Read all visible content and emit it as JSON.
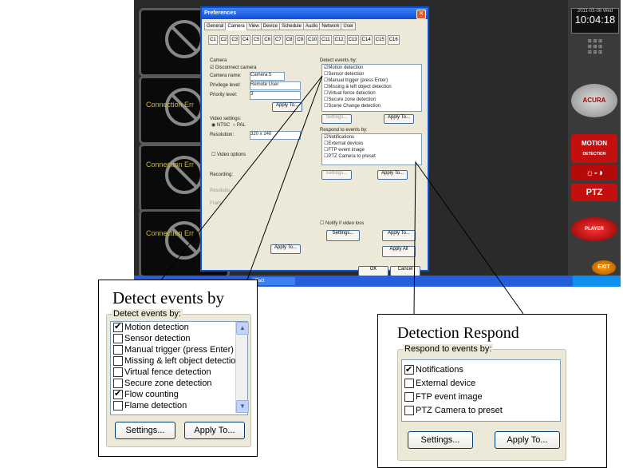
{
  "background_app": {
    "camera_tiles": [
      {
        "status": ""
      },
      {
        "status": "Connection Err"
      },
      {
        "status": "Connection Err"
      },
      {
        "status": "Connection Err"
      }
    ],
    "clock": {
      "date": "2011-03-08 Wed",
      "time": "10:04:18"
    },
    "side_buttons": {
      "motion_line1": "MOTION",
      "motion_line2": "DETECTION",
      "ptz": "PTZ",
      "acura": "ACURA",
      "player": "PLAYER",
      "exit": "EXIT"
    }
  },
  "preferences_dialog": {
    "title": "Preferences",
    "tabs": [
      "General",
      "Camera",
      "View",
      "Device",
      "Schedule",
      "Audio",
      "Network",
      "User"
    ],
    "camera_tabs": [
      "C1",
      "C2",
      "C3",
      "C4",
      "C5",
      "C6",
      "C7",
      "C8",
      "C9",
      "C10",
      "C11",
      "C12",
      "C13",
      "C14",
      "C15",
      "C16"
    ],
    "camera_group": {
      "label": "Camera",
      "disconnect_label": "Disconnect camera",
      "name_label": "Camera name:",
      "name_value": "Camera 5",
      "privilege_label": "Privilege level:",
      "privilege_value": "Remote User",
      "priority_label": "Priority level:",
      "priority_value": "3",
      "apply_to": "Apply To..."
    },
    "video_settings": {
      "label": "Video settings:",
      "ntsc": "NTSC",
      "pal": "PAL",
      "resolution_label": "Resolution:",
      "resolution_value": "320 x 240",
      "video_options": "Video options"
    },
    "recording": {
      "label": "Recording:",
      "resolution_label": "Resolutio",
      "framerate_label": "Fram",
      "apply_to": "Apply To..."
    },
    "detect_label": "Detect events by:",
    "detect_items": [
      "Motion detection",
      "Sensor detection",
      "Manual trigger (press Enter)",
      "Missing & left object detection",
      "Virtual fence detection",
      "Secure zone detection",
      "Scene Change detection"
    ],
    "respond_label": "Respond to events by:",
    "respond_items": [
      "Notifications",
      "External devices",
      "FTP event image",
      "PTZ Camera to preset"
    ],
    "settings_btn": "Settings...",
    "apply_to_btn": "Apply To...",
    "notify_video_loss": "Notify if video loss",
    "apply_all": "Apply All",
    "ok": "OK",
    "cancel": "Cancel"
  },
  "callout_detect": {
    "heading": "Detect events by",
    "group_label": "Detect events by:",
    "items": [
      {
        "label": "Motion detection",
        "checked": true
      },
      {
        "label": "Sensor detection",
        "checked": false
      },
      {
        "label": "Manual trigger (press Enter)",
        "checked": false
      },
      {
        "label": "Missing & left object detection",
        "checked": false
      },
      {
        "label": "Virtual fence detection",
        "checked": false
      },
      {
        "label": "Secure zone detection",
        "checked": false
      },
      {
        "label": "Flow counting",
        "checked": true
      },
      {
        "label": "Flame detection",
        "checked": false
      }
    ],
    "settings_btn": "Settings...",
    "apply_btn": "Apply To..."
  },
  "callout_respond": {
    "heading": "Detection Respond",
    "group_label": "Respond to events by:",
    "items": [
      {
        "label": "Notifications",
        "checked": true
      },
      {
        "label": "External device",
        "checked": false
      },
      {
        "label": "FTP event image",
        "checked": false
      },
      {
        "label": "PTZ Camera to preset",
        "checked": false
      }
    ],
    "settings_btn": "Settings...",
    "apply_btn": "Apply To..."
  },
  "taskbar": {
    "start_item": "Fact"
  }
}
